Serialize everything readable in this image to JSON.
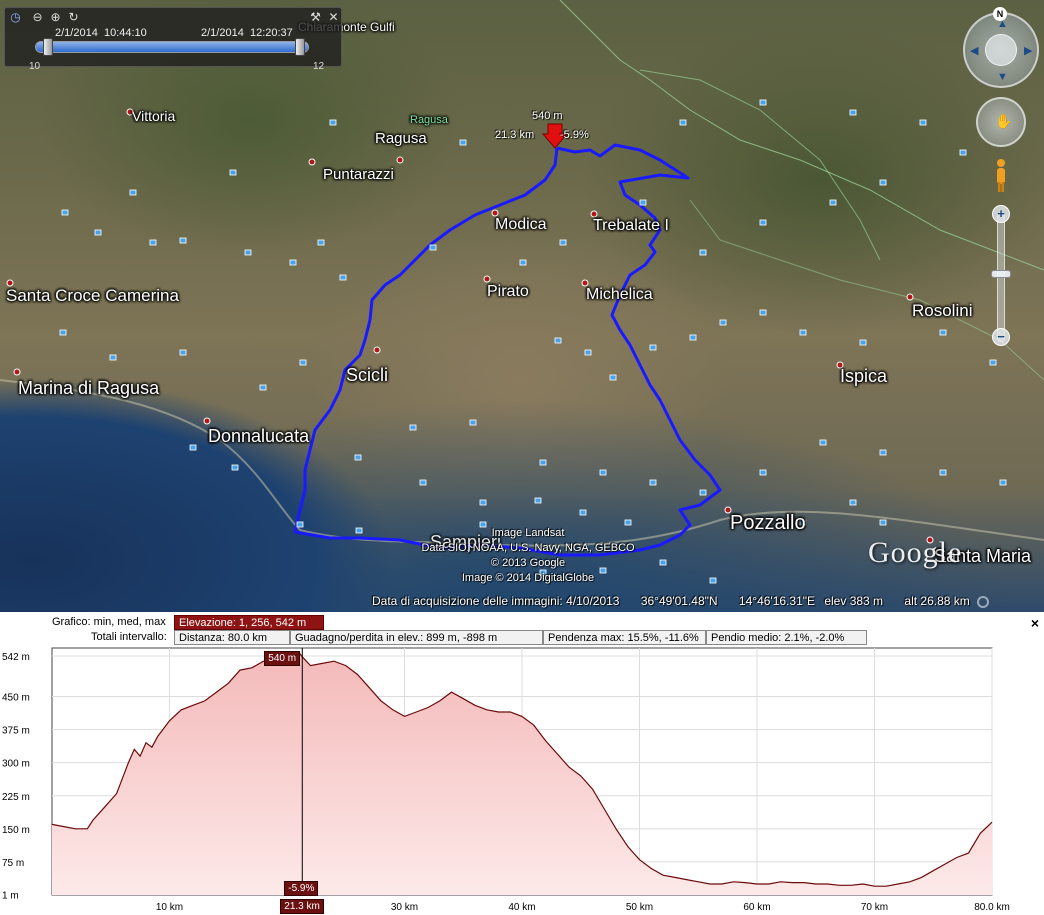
{
  "time_slider": {
    "start_date": "2/1/2014",
    "start_time": "10:44:10",
    "end_date": "2/1/2014",
    "end_time": "12:20:37",
    "tick_left": "10",
    "tick_right": "12"
  },
  "map": {
    "places": [
      {
        "name": "Chiaramonte Gulfi",
        "size": "small"
      },
      {
        "name": "Vittoria",
        "size": "small"
      },
      {
        "name": "Ragusa",
        "size": "green"
      },
      {
        "name": "Ragusa",
        "size": "mid"
      },
      {
        "name": "Puntarazzi",
        "size": "mid"
      },
      {
        "name": "Modica",
        "size": "mid"
      },
      {
        "name": "Trebalate I",
        "size": "mid"
      },
      {
        "name": "Santa Croce Camerina",
        "size": "big"
      },
      {
        "name": "Pirato",
        "size": "mid"
      },
      {
        "name": "Michelica",
        "size": "mid"
      },
      {
        "name": "Rosolini",
        "size": "mid"
      },
      {
        "name": "Scicli",
        "size": "big"
      },
      {
        "name": "Marina di Ragusa",
        "size": "big"
      },
      {
        "name": "Ispica",
        "size": "big"
      },
      {
        "name": "Donnalucata",
        "size": "big"
      },
      {
        "name": "Pozzallo",
        "size": "big"
      },
      {
        "name": "Sampieri",
        "size": "big"
      },
      {
        "name": "Santa Maria",
        "size": "big"
      }
    ],
    "cursor": {
      "elevation": "540 m",
      "distance": "21.3 km",
      "slope": "-5.9%"
    },
    "credits": [
      "Image Landsat",
      "Data SIO, NOAA, U.S. Navy, NGA, GEBCO",
      "© 2013 Google",
      "Image © 2014 DigitalGlobe"
    ],
    "logo": "Google",
    "north_label": "N",
    "status": {
      "imagery_date": "Data di acquisizione delle immagini: 4/10/2013",
      "lat": "36°49'01.48\"N",
      "lon": "14°46'16.31\"E",
      "elev": "elev   383 m",
      "alt": "alt  26.88 km"
    },
    "colors": {
      "track": "#1a1aff",
      "pin": "#e01010"
    }
  },
  "profile": {
    "row1_label": "Grafico: min, med, max",
    "elevation_cell": "Elevazione: 1, 256, 542 m",
    "row2_label": "Totali intervallo:",
    "distance_cell": "Distanza: 80.0 km",
    "gain_cell": "Guadagno/perdita in elev.: 899 m, -898 m",
    "slope_max_cell": "Pendenza max: 15.5%, -11.6%",
    "slope_avg_cell": "Pendio medio: 2.1%, -2.0%",
    "close_label": "×",
    "cursor_elev_badge": "540 m",
    "cursor_slope_badge": "-5.9%",
    "cursor_dist_badge": "21.3 km"
  },
  "chart_data": {
    "type": "area",
    "xlabel": "",
    "ylabel": "",
    "xlim": [
      0,
      80
    ],
    "ylim": [
      0,
      560
    ],
    "x_ticks": [
      {
        "value": 10,
        "label": "10 km"
      },
      {
        "value": 30,
        "label": "30 km"
      },
      {
        "value": 40,
        "label": "40 km"
      },
      {
        "value": 50,
        "label": "50 km"
      },
      {
        "value": 60,
        "label": "60 km"
      },
      {
        "value": 70,
        "label": "70 km"
      },
      {
        "value": 80,
        "label": "80.0 km"
      }
    ],
    "y_ticks": [
      {
        "value": 1,
        "label": "1 m"
      },
      {
        "value": 75,
        "label": "75 m"
      },
      {
        "value": 150,
        "label": "150 m"
      },
      {
        "value": 225,
        "label": "225 m"
      },
      {
        "value": 300,
        "label": "300 m"
      },
      {
        "value": 375,
        "label": "375 m"
      },
      {
        "value": 450,
        "label": "450 m"
      },
      {
        "value": 542,
        "label": "542 m"
      }
    ],
    "cursor_x": 21.3,
    "series": [
      {
        "x": [
          0,
          1,
          2,
          3,
          3.5,
          4.5,
          5.5,
          6.5,
          7,
          7.5,
          8,
          8.5,
          9,
          10,
          11,
          12,
          13,
          14,
          15,
          16,
          17,
          18,
          19,
          20,
          21,
          21.3,
          22,
          23,
          24,
          25,
          26,
          27,
          28,
          29,
          30,
          31,
          32,
          33,
          34,
          35,
          36,
          37,
          38,
          39,
          40,
          41,
          42,
          43,
          44,
          45,
          46,
          47,
          48,
          49,
          50,
          51,
          52,
          53,
          54,
          55,
          56,
          57,
          58,
          59,
          60,
          61,
          62,
          63,
          64,
          65,
          66,
          67,
          68,
          69,
          70,
          71,
          72,
          73,
          74,
          75,
          76,
          77,
          78,
          79,
          80
        ],
        "y": [
          160,
          155,
          150,
          150,
          170,
          200,
          230,
          300,
          330,
          315,
          345,
          335,
          360,
          395,
          420,
          430,
          440,
          460,
          480,
          510,
          515,
          530,
          525,
          545,
          550,
          540,
          520,
          525,
          530,
          520,
          500,
          470,
          440,
          420,
          405,
          415,
          425,
          440,
          460,
          445,
          430,
          420,
          415,
          415,
          405,
          385,
          350,
          320,
          290,
          270,
          240,
          195,
          150,
          110,
          80,
          60,
          45,
          40,
          35,
          30,
          25,
          25,
          30,
          28,
          25,
          25,
          30,
          28,
          28,
          25,
          25,
          22,
          22,
          25,
          20,
          20,
          25,
          30,
          40,
          55,
          70,
          85,
          95,
          140,
          165
        ]
      }
    ]
  }
}
